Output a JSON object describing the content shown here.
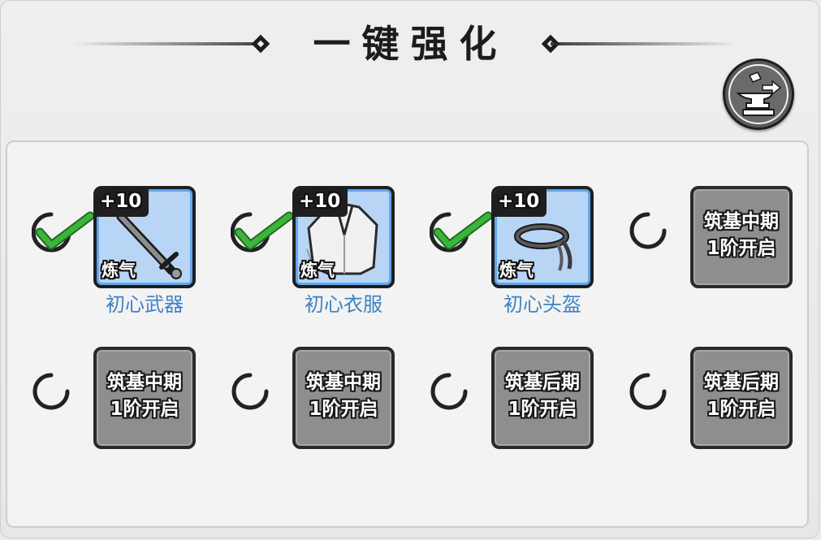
{
  "title": "一键强化",
  "icons": {
    "enhance_button": "anvil-hammer-icon"
  },
  "colors": {
    "check_green": "#3cb43c",
    "item_name_blue": "#3c82c4",
    "tile_blue": "#b9d5f6",
    "tile_locked": "#8e8e8e"
  },
  "slots": [
    {
      "state": "checked",
      "level": "+10",
      "realm": "炼气",
      "name": "初心武器",
      "icon": "sword-icon"
    },
    {
      "state": "checked",
      "level": "+10",
      "realm": "炼气",
      "name": "初心衣服",
      "icon": "robe-icon"
    },
    {
      "state": "checked",
      "level": "+10",
      "realm": "炼气",
      "name": "初心头盔",
      "icon": "headband-icon"
    },
    {
      "state": "locked",
      "lock_line1": "筑基中期",
      "lock_line2": "1阶开启"
    },
    {
      "state": "locked",
      "lock_line1": "筑基中期",
      "lock_line2": "1阶开启"
    },
    {
      "state": "locked",
      "lock_line1": "筑基中期",
      "lock_line2": "1阶开启"
    },
    {
      "state": "locked",
      "lock_line1": "筑基后期",
      "lock_line2": "1阶开启"
    },
    {
      "state": "locked",
      "lock_line1": "筑基后期",
      "lock_line2": "1阶开启"
    }
  ]
}
